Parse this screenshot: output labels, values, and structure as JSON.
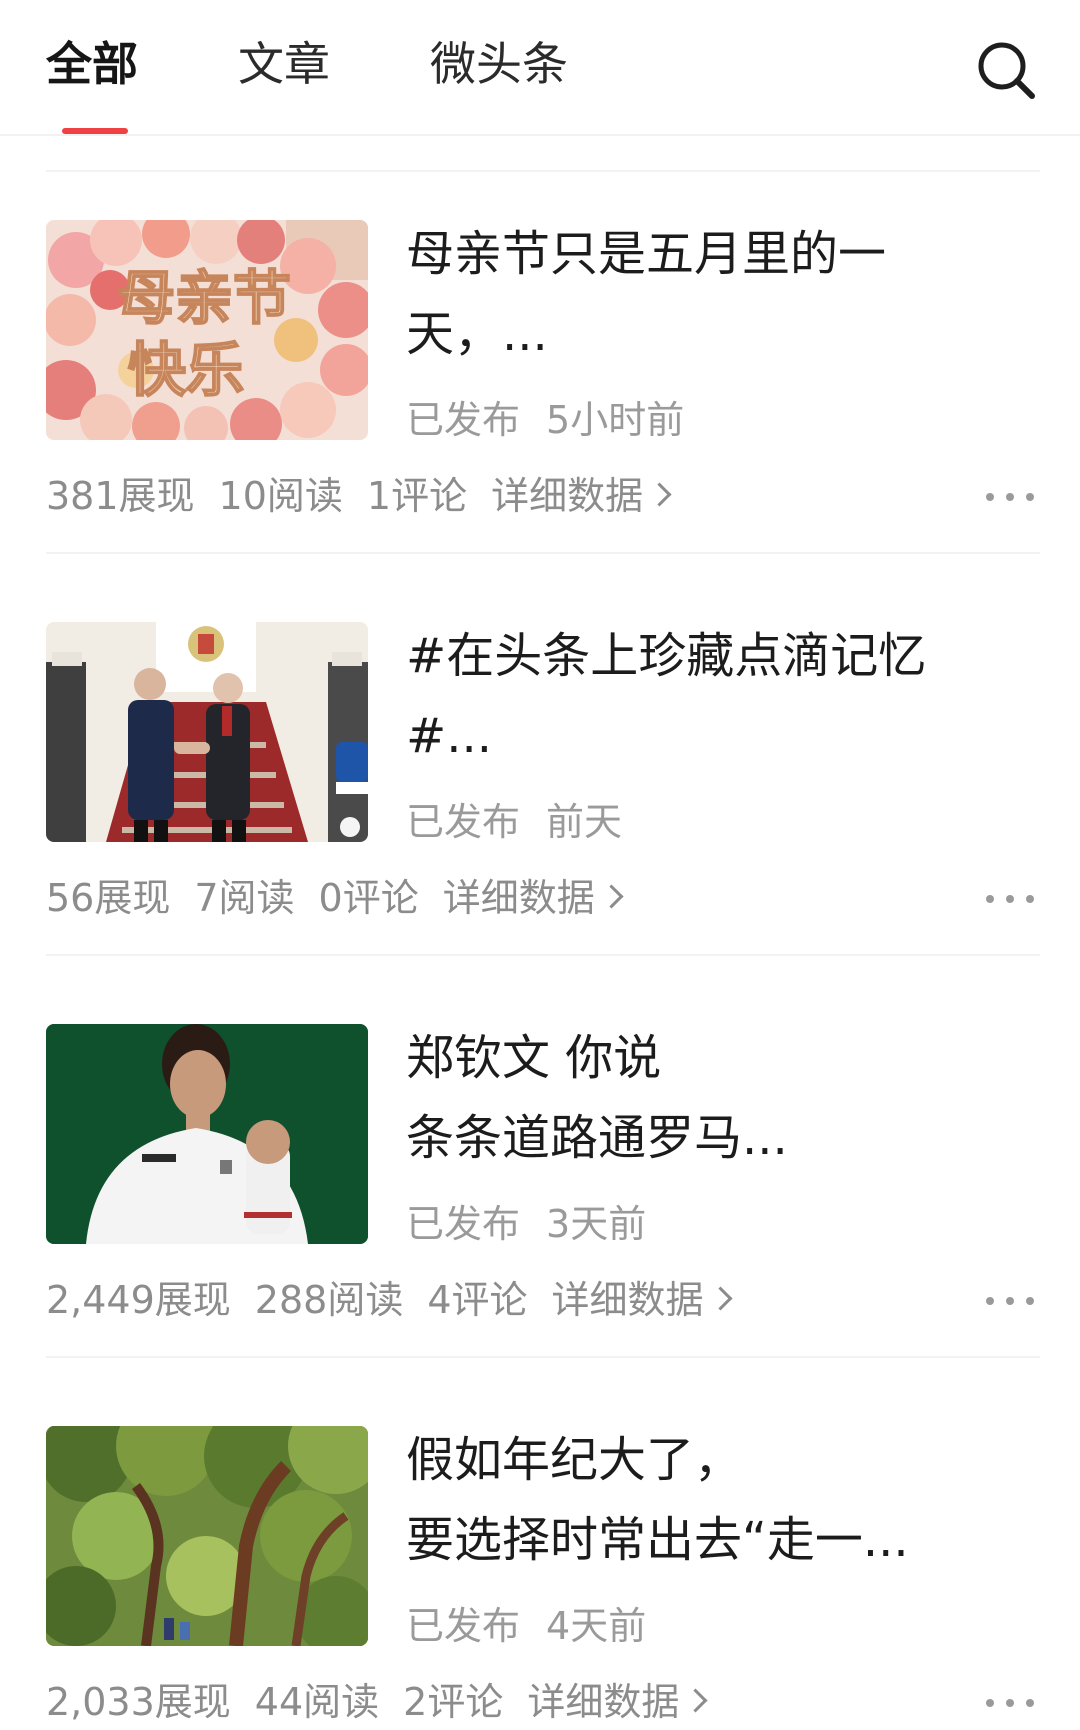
{
  "tabs": {
    "all": "全部",
    "article": "文章",
    "micro": "微头条"
  },
  "colors": {
    "accent": "#f04142",
    "meta_text": "#9a9a9a"
  },
  "icons": {
    "search": "search-icon",
    "more": "more-icon",
    "chevron": "chevron-right-icon"
  },
  "articles": [
    {
      "title_line1": "母亲节只是五月里的一",
      "title_line2": "天，...",
      "status": "已发布",
      "time": "5小时前",
      "views": "381展现",
      "reads": "10阅读",
      "comments": "1评论",
      "detail": "详细数据",
      "thumb_text_line1": "母亲节",
      "thumb_text_line2": "快乐"
    },
    {
      "title_line1": "#在头条上珍藏点滴记忆",
      "title_line2": "#...",
      "status": "已发布",
      "time": "前天",
      "views": "56展现",
      "reads": "7阅读",
      "comments": "0评论",
      "detail": "详细数据"
    },
    {
      "title_line1": "郑钦文 你说",
      "title_line2": "条条道路通罗马...",
      "status": "已发布",
      "time": "3天前",
      "views": "2,449展现",
      "reads": "288阅读",
      "comments": "4评论",
      "detail": "详细数据"
    },
    {
      "title_line1": "假如年纪大了，",
      "title_line2": "要选择时常出去“走一...",
      "status": "已发布",
      "time": "4天前",
      "views": "2,033展现",
      "reads": "44阅读",
      "comments": "2评论",
      "detail": "详细数据"
    }
  ]
}
